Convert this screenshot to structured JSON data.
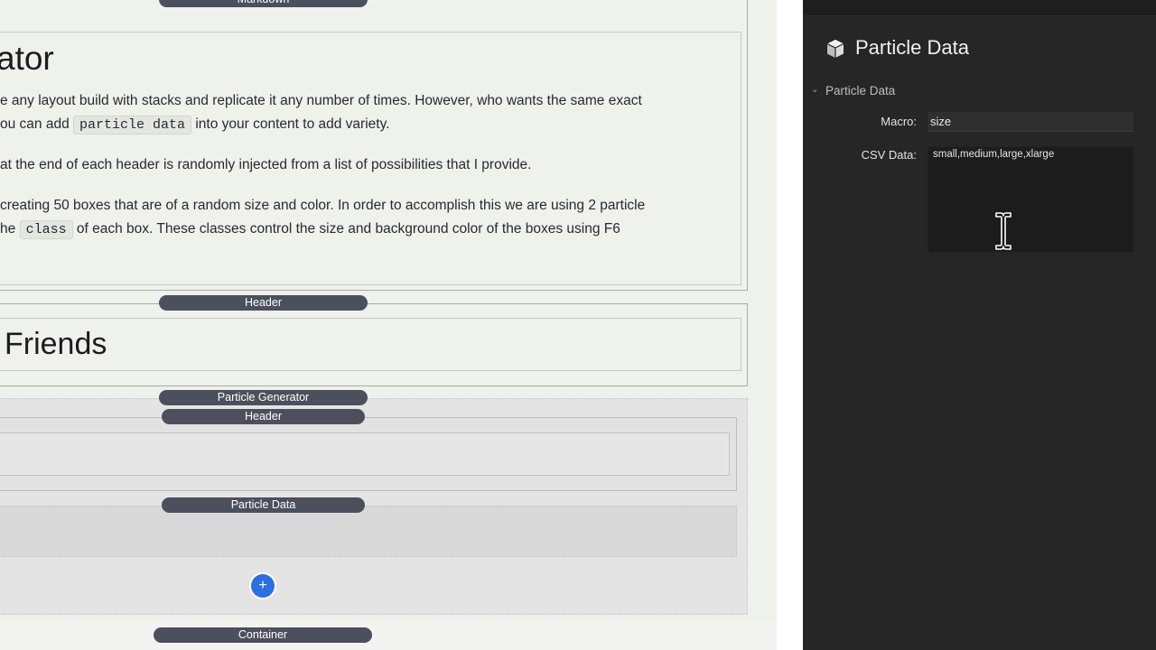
{
  "editor": {
    "markdown_stack_label": "Markdown",
    "markdown": {
      "title": "ator",
      "para1_line1": "e any layout build with stacks and replicate it any number of times. However, who wants the same exact",
      "para1_line2_before": "ou can add ",
      "para1_code": "particle data",
      "para1_line2_after": " into your content to add variety.",
      "para2": "at the end of each header is randomly injected from a list of possibilities that I provide.",
      "para3_line1": "creating 50 boxes that are of a random size and color. In order to accomplish this we are using 2 particle",
      "para3_line2_before": "he ",
      "para3_code": "class",
      "para3_line2_after": " of each box. These classes control the size and background color of the boxes using F6"
    },
    "header_stack_label": "Header",
    "header_title": "Friends",
    "particle_generator_label": "Particle Generator",
    "inner_header_label": "Header",
    "particle_data_label": "Particle Data",
    "add_button_glyph": "+",
    "container_label": "Container"
  },
  "inspector": {
    "title": "Particle Data",
    "icon": "cube-icon",
    "section_header": "Particle Data",
    "section_chevron": "chevron-down-icon",
    "macro_label": "Macro:",
    "macro_value": "size",
    "csv_label": "CSV Data:",
    "csv_value": "small,medium,large,xlarge"
  },
  "colors": {
    "stack_label_bg": "#4d4f5c",
    "inspector_bg": "#262626",
    "add_button": "#2d6fe0",
    "editor_bg": "#eef1ec"
  }
}
